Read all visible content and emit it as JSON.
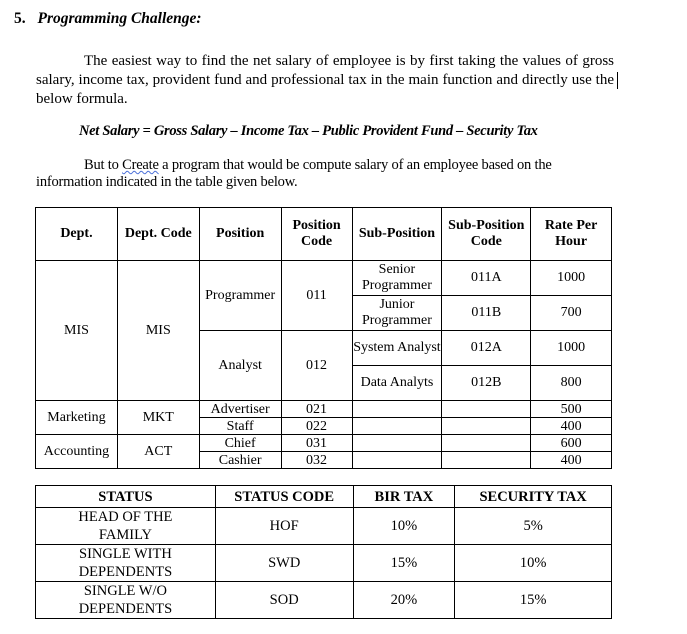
{
  "section": {
    "number": "5.",
    "title": "Programming Challenge:"
  },
  "intro_paragraph": "The easiest way to find the net salary of employee is by first taking the values of gross salary, income tax, provident fund and professional tax in the main function and directly use the below formula.",
  "formula": "Net Salary = Gross Salary – Income Tax – Public Provident Fund – Security Tax",
  "instruction": {
    "before": "But to ",
    "flagged_word": "Create",
    "after": " a program that would be compute salary of an employee based on the information indicated in the table given below."
  },
  "position_table": {
    "headers": [
      "Dept.",
      "Dept. Code",
      "Position",
      "Position Code",
      "Sub-Position",
      "Sub-Position Code",
      "Rate Per Hour"
    ],
    "departments": [
      {
        "dept": "MIS",
        "dept_code": "MIS",
        "positions": [
          {
            "position": "Programmer",
            "code": "011",
            "subs": [
              {
                "name": "Senior Programmer",
                "code": "011A",
                "rate": "1000"
              },
              {
                "name": "Junior Programmer",
                "code": "011B",
                "rate": "700"
              }
            ]
          },
          {
            "position": "Analyst",
            "code": "012",
            "subs": [
              {
                "name": "System Analyst",
                "code": "012A",
                "rate": "1000"
              },
              {
                "name": "Data Analyts",
                "code": "012B",
                "rate": "800"
              }
            ]
          }
        ]
      },
      {
        "dept": "Marketing",
        "dept_code": "MKT",
        "positions": [
          {
            "position": "Advertiser",
            "code": "021",
            "subs": [
              {
                "name": "",
                "code": "",
                "rate": "500"
              }
            ]
          },
          {
            "position": "Staff",
            "code": "022",
            "subs": [
              {
                "name": "",
                "code": "",
                "rate": "400"
              }
            ]
          }
        ]
      },
      {
        "dept": "Accounting",
        "dept_code": "ACT",
        "positions": [
          {
            "position": "Chief",
            "code": "031",
            "subs": [
              {
                "name": "",
                "code": "",
                "rate": "600"
              }
            ]
          },
          {
            "position": "Cashier",
            "code": "032",
            "subs": [
              {
                "name": "",
                "code": "",
                "rate": "400"
              }
            ]
          }
        ]
      }
    ]
  },
  "status_table": {
    "headers": [
      "STATUS",
      "STATUS CODE",
      "BIR TAX",
      "SECURITY TAX"
    ],
    "rows": [
      {
        "status": "HEAD OF THE FAMILY",
        "code": "HOF",
        "bir_tax": "10%",
        "security_tax": "5%"
      },
      {
        "status": "SINGLE WITH DEPENDENTS",
        "code": "SWD",
        "bir_tax": "15%",
        "security_tax": "10%"
      },
      {
        "status": "SINGLE W/O DEPENDENTS",
        "code": "SOD",
        "bir_tax": "20%",
        "security_tax": "15%"
      }
    ]
  }
}
